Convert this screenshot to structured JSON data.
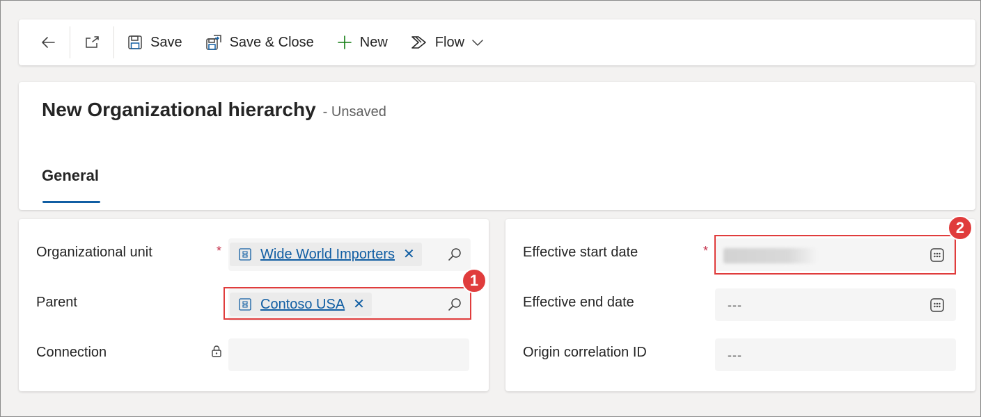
{
  "toolbar": {
    "back_icon": "arrow-left-icon",
    "popout_icon": "open-in-new-window-icon",
    "save_label": "Save",
    "save_close_label": "Save & Close",
    "new_label": "New",
    "flow_label": "Flow"
  },
  "header": {
    "title": "New Organizational hierarchy",
    "status": "- Unsaved",
    "tabs": [
      {
        "label": "General",
        "selected": true
      }
    ]
  },
  "form": {
    "left": {
      "organizational_unit": {
        "label": "Organizational unit",
        "required": true,
        "value": "Wide World Importers"
      },
      "parent": {
        "label": "Parent",
        "value": "Contoso USA"
      },
      "connection": {
        "label": "Connection",
        "locked": true,
        "value": ""
      }
    },
    "right": {
      "effective_start_date": {
        "label": "Effective start date",
        "required": true,
        "value": ""
      },
      "effective_end_date": {
        "label": "Effective end date",
        "value": "---"
      },
      "origin_correlation_id": {
        "label": "Origin correlation ID",
        "value": "---"
      }
    }
  },
  "required_marker": "*",
  "callouts": [
    {
      "number": "1"
    },
    {
      "number": "2"
    }
  ],
  "colors": {
    "accent": "#115ea3",
    "required": "#c4314b",
    "callout": "#e03c3c",
    "new_icon": "#107c10"
  }
}
